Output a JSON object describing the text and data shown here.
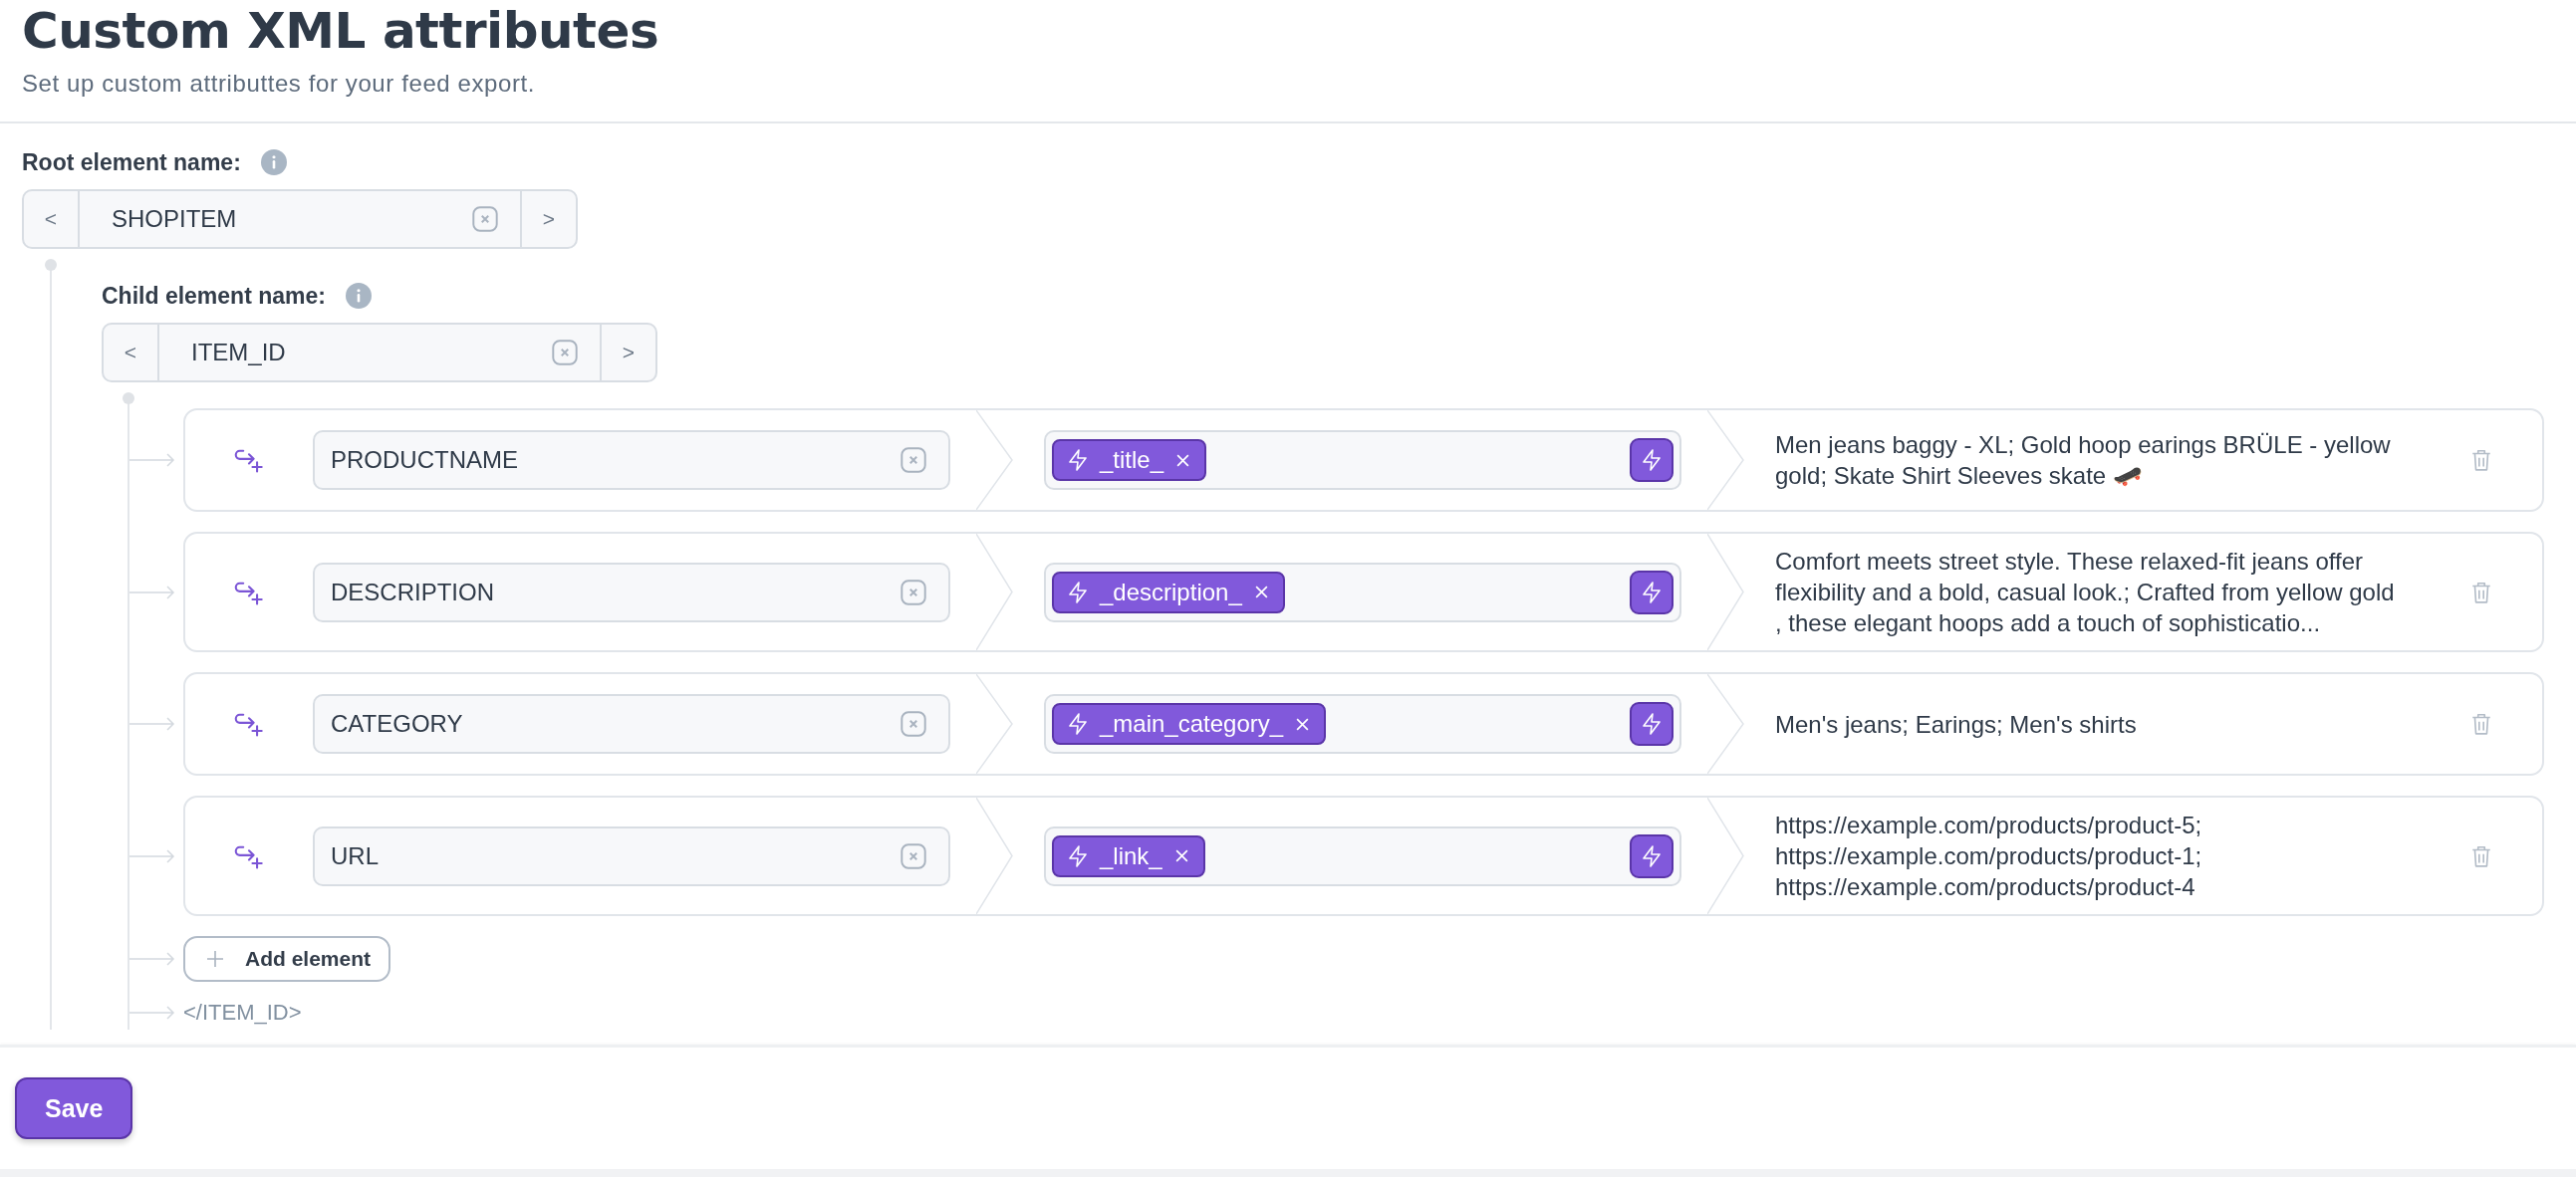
{
  "header": {
    "title": "Custom XML attributes",
    "subtitle": "Set up custom attributtes for your feed export."
  },
  "root": {
    "label": "Root element name:",
    "prev": "<",
    "value": "SHOPITEM",
    "next": ">"
  },
  "child": {
    "label": "Child element name:",
    "prev": "<",
    "value": "ITEM_ID",
    "next": ">",
    "closing_tag": "</ITEM_ID>"
  },
  "rows": [
    {
      "name": "PRODUCTNAME",
      "token": "_title_",
      "preview": "Men jeans baggy - XL; Gold hoop earings BRÜLE - yellow gold; Skate Shirt Sleeves skate 🛹"
    },
    {
      "name": "DESCRIPTION",
      "token": "_description_",
      "preview": "Comfort meets street style. These relaxed-fit jeans offer flexibility and a bold, casual look.; Crafted from yellow gold , these elegant hoops add a touch of sophisticatio..."
    },
    {
      "name": "CATEGORY",
      "token": "_main_category_",
      "preview": "Men's jeans; Earings; Men's shirts"
    },
    {
      "name": "URL",
      "token": "_link_",
      "preview": "https://example.com/products/product-5; https://example.com/products/product-1; https://example.com/products/product-4"
    }
  ],
  "add_button": "Add element",
  "save_button": "Save"
}
